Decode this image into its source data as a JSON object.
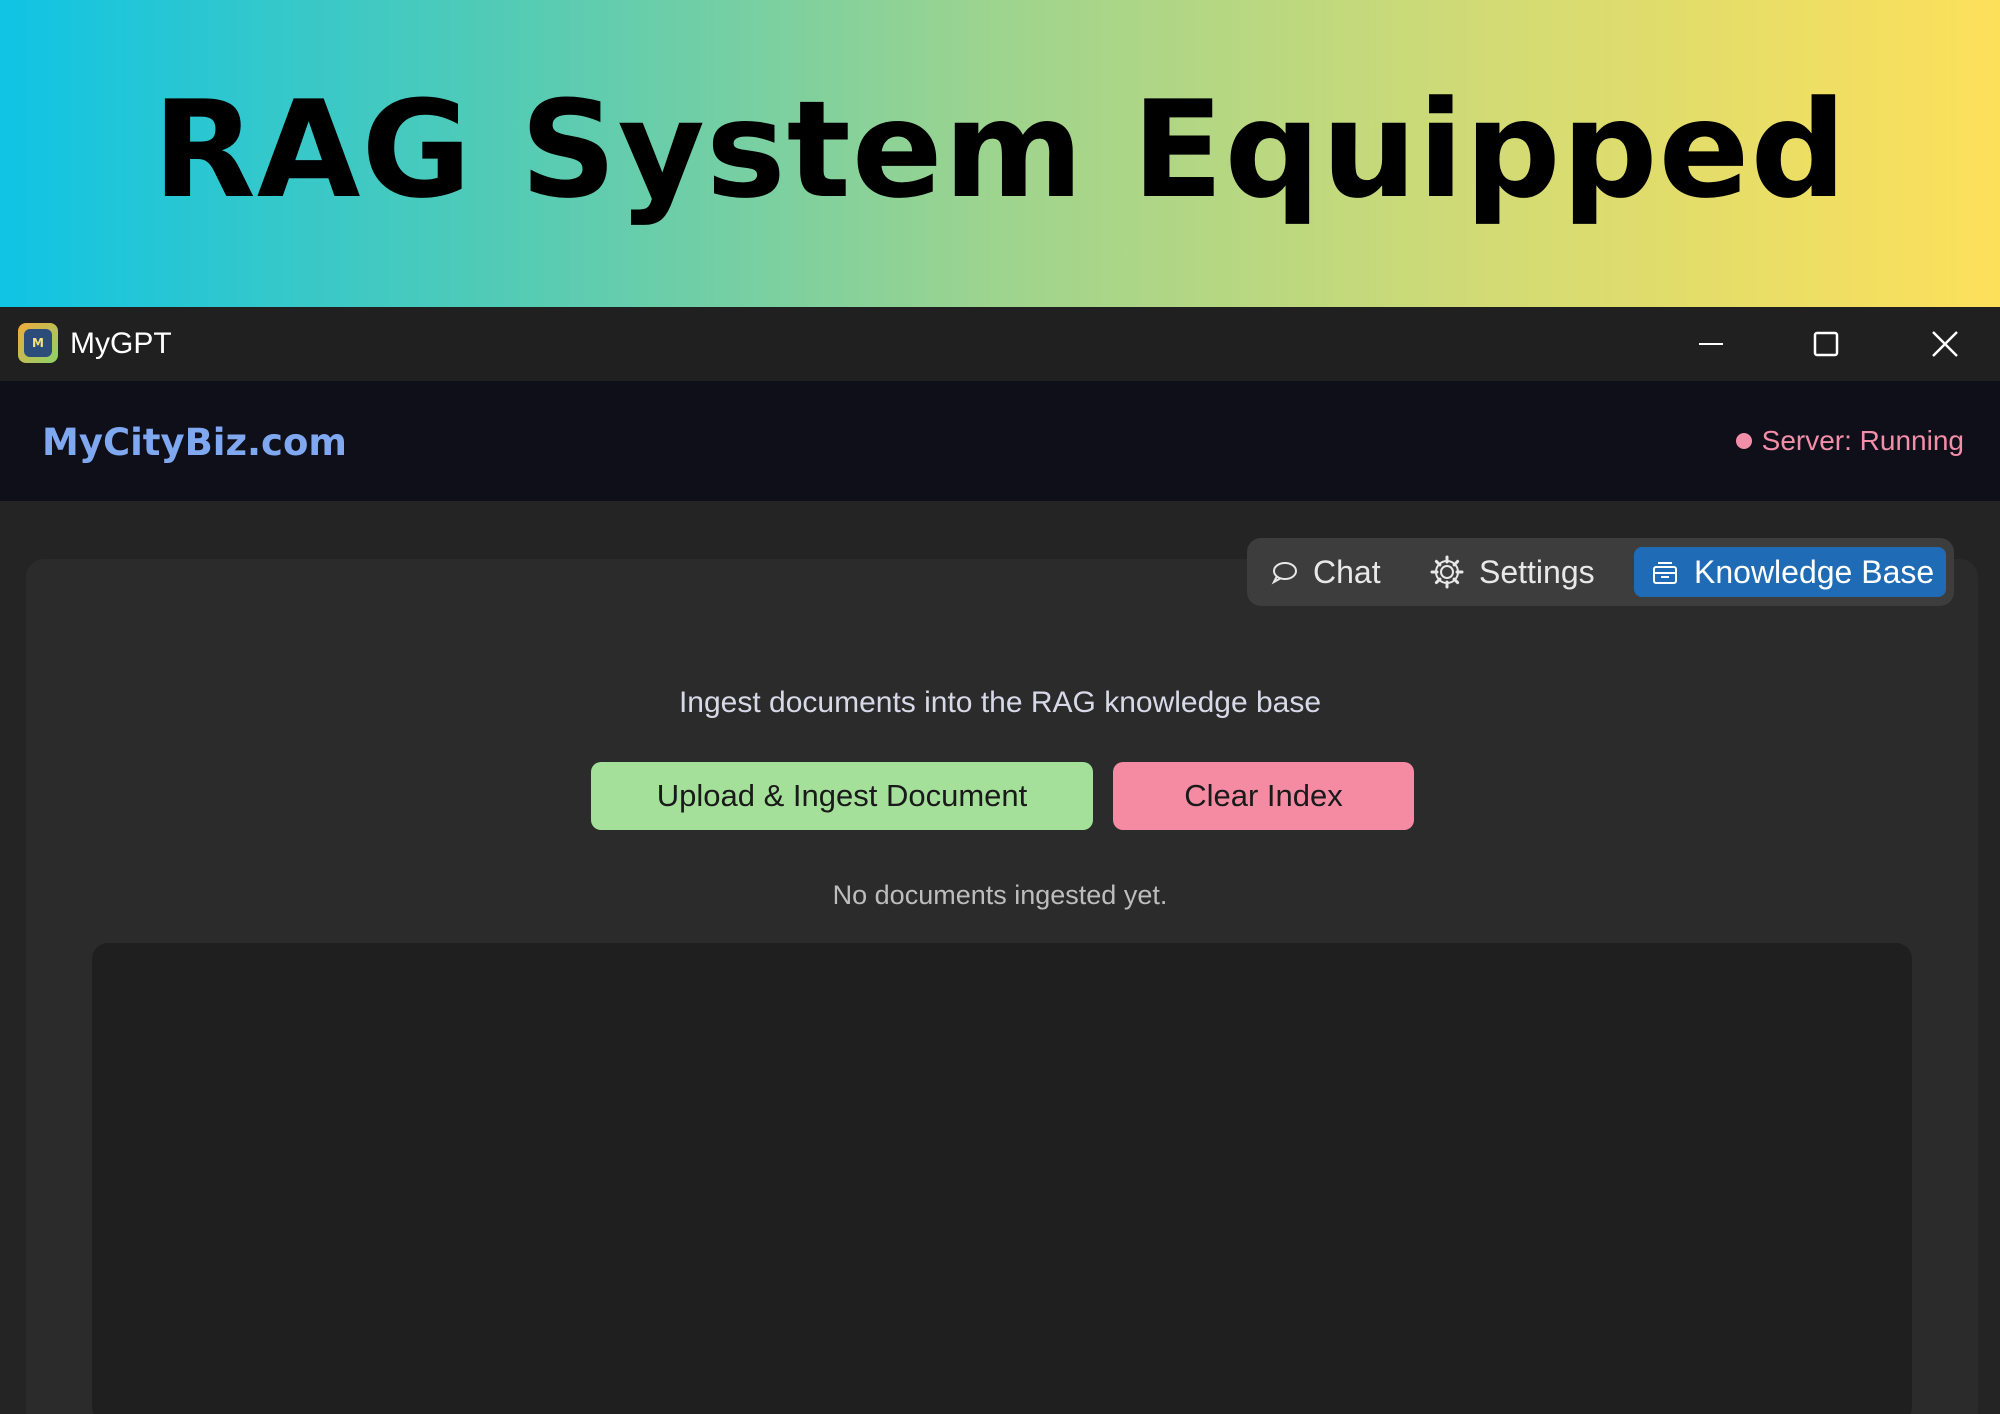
{
  "banner": {
    "title": "RAG System Equipped"
  },
  "window": {
    "app_icon_text": "M",
    "title": "MyGPT"
  },
  "header": {
    "brand": "MyCityBiz.com",
    "server_status": "Server: Running",
    "status_color": "#f28ea8"
  },
  "tabs": [
    {
      "label": "Chat",
      "icon": "chat-bubble-icon",
      "active": false
    },
    {
      "label": "Settings",
      "icon": "gear-icon",
      "active": false
    },
    {
      "label": "Knowledge Base",
      "icon": "archive-icon",
      "active": true
    }
  ],
  "knowledge_base": {
    "subtitle": "Ingest documents into the RAG knowledge base",
    "upload_label": "Upload & Ingest Document",
    "clear_label": "Clear Index",
    "empty_message": "No documents ingested yet."
  },
  "colors": {
    "accent": "#1f6bb5",
    "upload": "#a4e09a",
    "clear": "#f48ba3",
    "brand": "#7fa8f0"
  }
}
